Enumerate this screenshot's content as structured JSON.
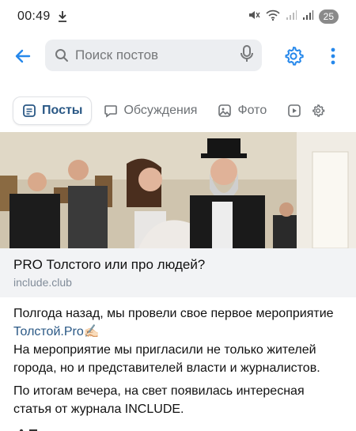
{
  "status_bar": {
    "time": "00:49",
    "battery": "25"
  },
  "search": {
    "placeholder": "Поиск постов"
  },
  "tabs": [
    {
      "label": "Посты",
      "icon": "posts-icon",
      "active": true
    },
    {
      "label": "Обсуждения",
      "icon": "discussions-icon",
      "active": false
    },
    {
      "label": "Фото",
      "icon": "photo-icon",
      "active": false
    },
    {
      "label": "",
      "icon": "video-icon",
      "active": false
    }
  ],
  "post": {
    "link_title": "PRO Толстого или про людей?",
    "link_domain": "include.club",
    "paragraphs": {
      "p1_text": "Полгода назад, мы провели свое первое мероприятие",
      "p1_link": "Толстой.Pro",
      "p1_emoji": "✍🏻",
      "p2": "На мероприятие мы пригласили не только жителей города, но и представителей власти и журналистов.",
      "p3": "По итогам вечера, на свет появилась интересная статья от журнала INCLUDE."
    }
  },
  "colors": {
    "accent": "#2a5885",
    "icon_blue": "#2688eb",
    "search_bg": "#eceef1",
    "card_bg": "#f2f3f5"
  }
}
